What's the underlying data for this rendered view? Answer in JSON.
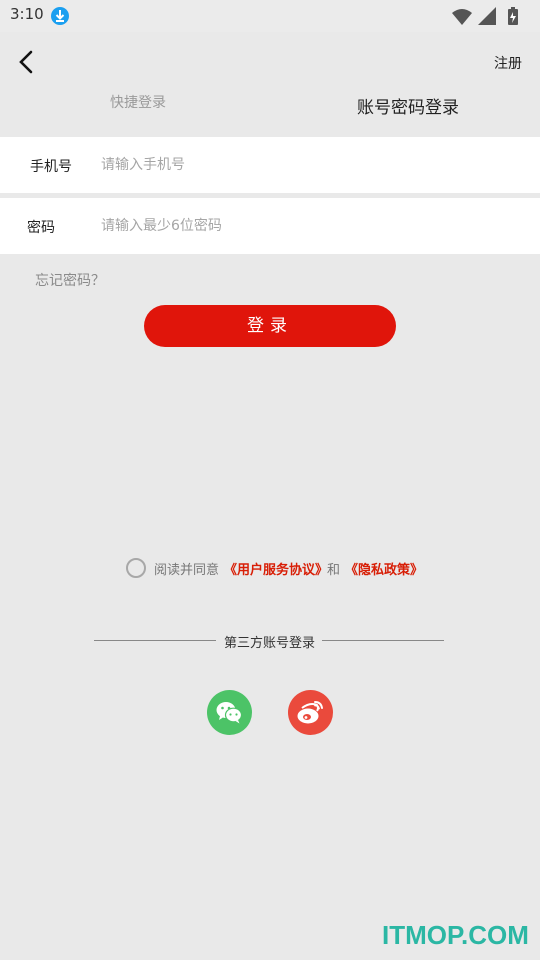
{
  "status_bar": {
    "time": "3:10",
    "icons": [
      "download-icon",
      "wifi-icon",
      "signal-icon",
      "battery-icon"
    ]
  },
  "header": {
    "back_icon": "back-arrow-icon",
    "register_label": "注册",
    "tabs": [
      {
        "label": "快捷登录",
        "active": false
      },
      {
        "label": "账号密码登录",
        "active": true
      }
    ]
  },
  "form": {
    "phone": {
      "label": "手机号",
      "value": "",
      "placeholder": "请输入手机号"
    },
    "password": {
      "label": "密码",
      "value": "",
      "placeholder": "请输入最少6位密码"
    }
  },
  "forgot_label": "忘记密码？",
  "login_label": "登录",
  "agreement": {
    "checked": false,
    "prefix": "阅读并同意",
    "user_terms": "《用户服务协议》",
    "and": "和",
    "privacy": "《隐私政策》"
  },
  "third_party": {
    "label": "第三方账号登录",
    "providers": [
      {
        "name": "wechat",
        "icon": "wechat-icon",
        "color": "#4cc367"
      },
      {
        "name": "weibo",
        "icon": "weibo-icon",
        "color": "#ea4a3c"
      }
    ]
  },
  "colors": {
    "accent": "#e0150b",
    "link": "#d81e06",
    "background": "#e9e9e9"
  },
  "watermark": "ITMOP.COM"
}
